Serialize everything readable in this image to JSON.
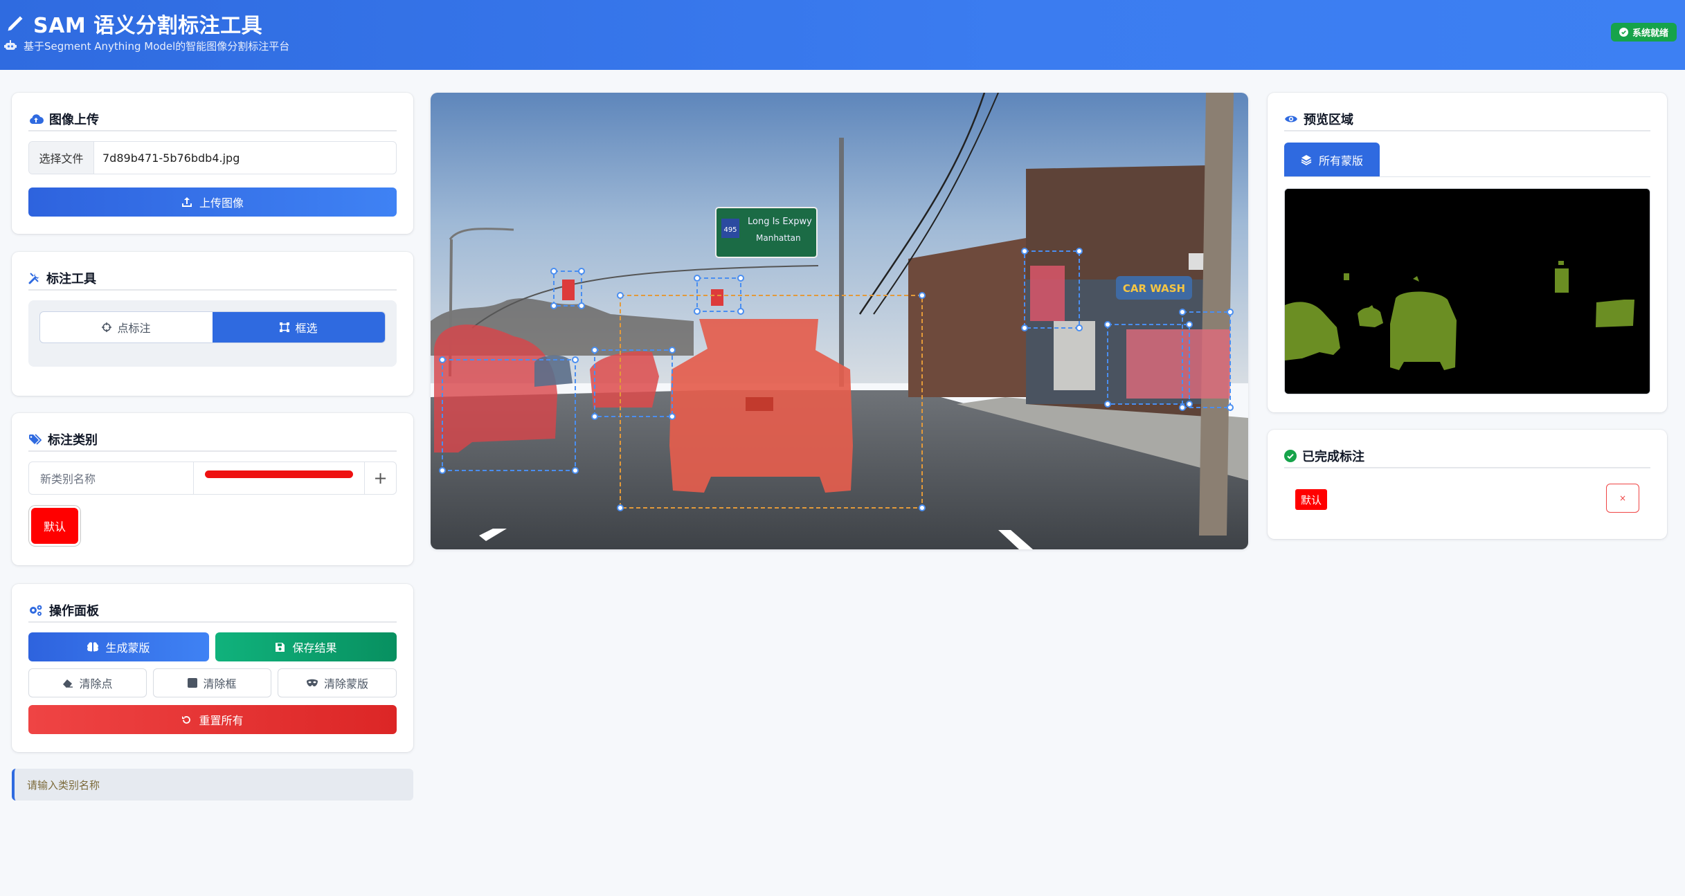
{
  "header": {
    "title": "SAM 语义分割标注工具",
    "subtitle": "基于Segment Anything Model的智能图像分割标注平台",
    "status": "系统就绪"
  },
  "upload": {
    "title": "图像上传",
    "choose_file": "选择文件",
    "file_name": "7d89b471-5b76bdb4.jpg",
    "upload_button": "上传图像"
  },
  "tools": {
    "title": "标注工具",
    "point": "点标注",
    "box": "框选",
    "active": "box"
  },
  "category": {
    "title": "标注类别",
    "placeholder": "新类别名称",
    "color": "#ee1111",
    "add": "+",
    "tags": [
      {
        "label": "默认",
        "color": "#ff0000"
      }
    ]
  },
  "ops": {
    "title": "操作面板",
    "generate": "生成蒙版",
    "save": "保存结果",
    "clear_points": "清除点",
    "clear_boxes": "清除框",
    "clear_masks": "清除蒙版",
    "reset": "重置所有"
  },
  "hint": "请输入类别名称",
  "canvas": {
    "sign_line1": "Long Is Expwy",
    "sign_line2": "Manhattan",
    "route": "495",
    "store_sign": "CAR WASH"
  },
  "preview": {
    "title": "预览区域",
    "tab": "所有蒙版",
    "mask_color": "#6b8e23"
  },
  "done": {
    "title": "已完成标注",
    "items": [
      {
        "label": "默认",
        "color": "#ff0000"
      }
    ],
    "delete": "×"
  }
}
